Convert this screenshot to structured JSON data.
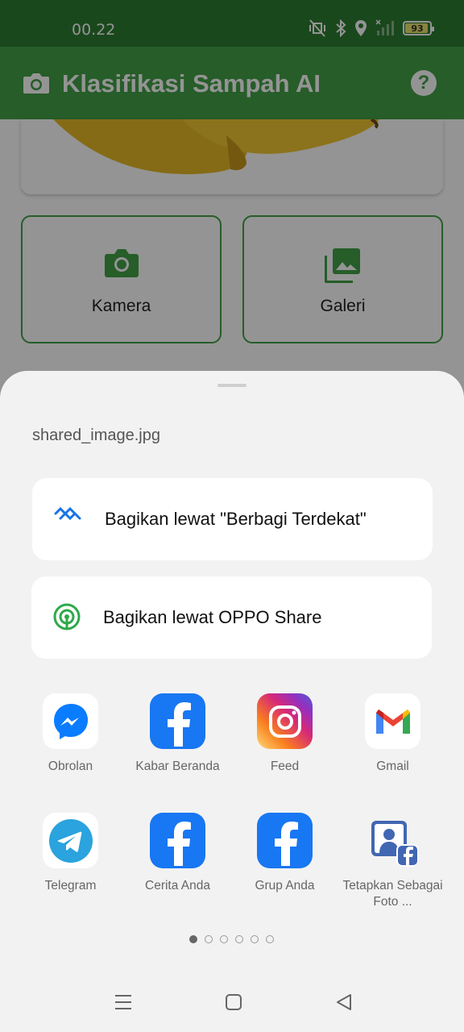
{
  "status_bar": {
    "time": "00.22",
    "battery": "93",
    "battery_level": 0.93
  },
  "app_bar": {
    "title": "Klasifikasi Sampah AI",
    "icon": "camera-icon",
    "help_icon": "help-icon"
  },
  "actions": [
    {
      "label": "Kamera",
      "icon": "camera-icon"
    },
    {
      "label": "Galeri",
      "icon": "gallery-icon"
    }
  ],
  "share_sheet": {
    "filename": "shared_image.jpg",
    "nearby_share": "Bagikan lewat \"Berbagi Terdekat\"",
    "oppo_share": "Bagikan lewat OPPO Share",
    "apps": [
      {
        "label": "Obrolan",
        "icon": "messenger-icon"
      },
      {
        "label": "Kabar Beranda",
        "icon": "facebook-icon"
      },
      {
        "label": "Feed",
        "icon": "instagram-icon"
      },
      {
        "label": "Gmail",
        "icon": "gmail-icon"
      },
      {
        "label": "Telegram",
        "icon": "telegram-icon"
      },
      {
        "label": "Cerita Anda",
        "icon": "facebook-icon"
      },
      {
        "label": "Grup Anda",
        "icon": "facebook-icon"
      },
      {
        "label": "Tetapkan Sebagai Foto ...",
        "icon": "facebook-profile-icon"
      }
    ],
    "page_count": 6,
    "active_page": 1
  },
  "colors": {
    "primary": "#43a047",
    "status_bar": "#2e7d32",
    "sheet": "#f2f2f2"
  }
}
